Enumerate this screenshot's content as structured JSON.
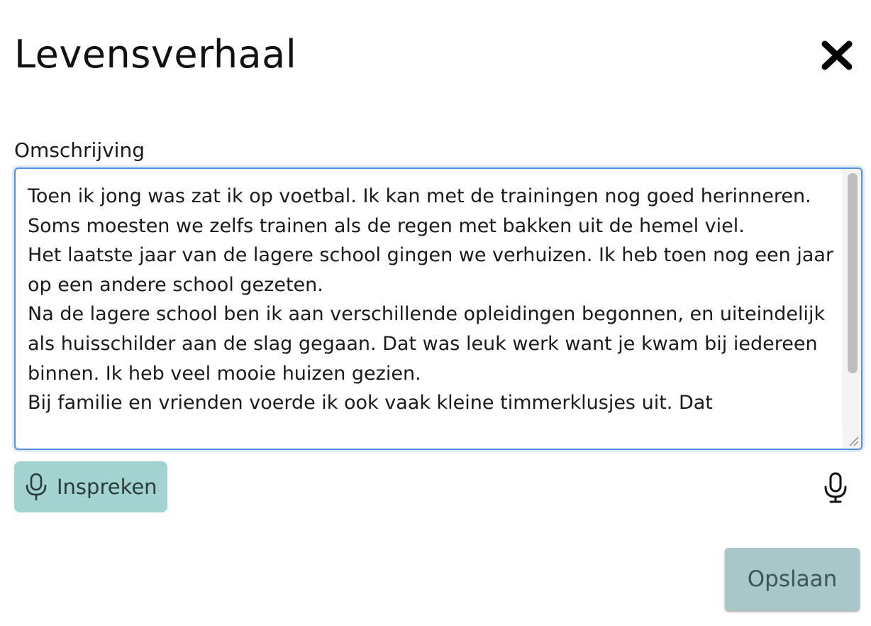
{
  "dialog": {
    "title": "Levensverhaal"
  },
  "field": {
    "label": "Omschrijving",
    "value": "Toen ik jong was zat ik op voetbal. Ik kan met de trainingen nog goed herinneren. Soms moesten we zelfs trainen als de regen met bakken uit de hemel viel.\nHet laatste jaar van de lagere school gingen we verhuizen. Ik heb toen nog een jaar op een andere school gezeten.\nNa de lagere school ben ik aan verschillende opleidingen begonnen, en uiteindelijk als huisschilder aan de slag gegaan. Dat was leuk werk want je kwam bij iedereen binnen. Ik heb veel mooie huizen gezien.\nBij familie en vrienden voerde ik ook vaak kleine timmerklusjes uit. Dat"
  },
  "actions": {
    "speak_label": "Inspreken",
    "save_label": "Opslaan"
  },
  "icons": {
    "close": "close-icon",
    "speak": "microphone-icon",
    "mic_toggle": "microphone-icon"
  },
  "colors": {
    "focus_border": "#4f8fe6",
    "speak_button_bg": "#a3d3d0",
    "save_button_bg": "#a7c7c9"
  }
}
